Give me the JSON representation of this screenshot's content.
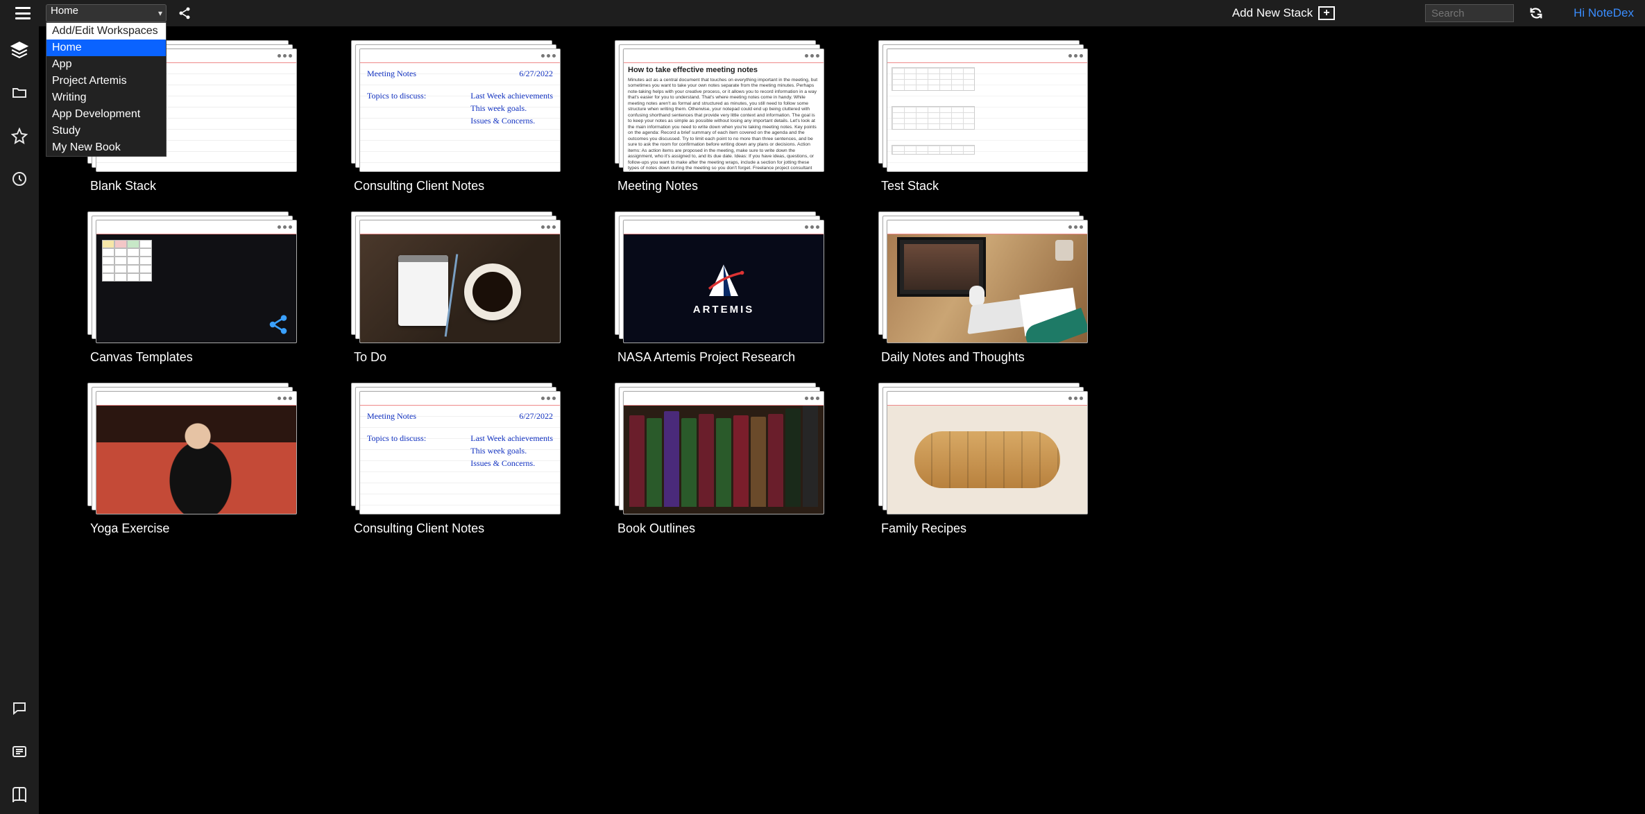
{
  "topbar": {
    "workspace_selected": "Home",
    "workspace_options": [
      "Add/Edit Workspaces",
      "Home",
      "App",
      "Project Artemis",
      "Writing",
      "App Development",
      "Study",
      "My New Book"
    ],
    "add_stack_label": "Add New Stack",
    "search_placeholder": "Search",
    "greeting": "Hi NoteDex"
  },
  "stacks": [
    {
      "title": "Blank Stack",
      "preview": "blank"
    },
    {
      "title": "Consulting Client Notes",
      "preview": "handwriting"
    },
    {
      "title": "Meeting Notes",
      "preview": "typed"
    },
    {
      "title": "Test Stack",
      "preview": "calendars"
    },
    {
      "title": "Canvas Templates",
      "preview": "darkcanvas"
    },
    {
      "title": "To Do",
      "preview": "coffee"
    },
    {
      "title": "NASA Artemis Project Research",
      "preview": "artemis"
    },
    {
      "title": "Daily Notes and Thoughts",
      "preview": "desk"
    },
    {
      "title": "Yoga Exercise",
      "preview": "yoga"
    },
    {
      "title": "Consulting Client Notes",
      "preview": "handwriting"
    },
    {
      "title": "Book Outlines",
      "preview": "books"
    },
    {
      "title": "Family Recipes",
      "preview": "bread"
    }
  ],
  "handwriting_preview": {
    "header_left": "Meeting Notes",
    "header_right": "6/27/2022",
    "line1": "Topics to discuss:",
    "bullets": [
      "Last Week achievements",
      "This week goals.",
      "Issues & Concerns."
    ]
  },
  "typed_preview": {
    "title": "How to take effective meeting notes",
    "body": "Minutes act as a central document that touches on everything important in the meeting, but sometimes you want to take your own notes separate from the meeting minutes. Perhaps note-taking helps with your creative process, or it allows you to record information in a way that's easier for you to understand. That's where meeting notes come in handy. While meeting notes aren't as formal and structured as minutes, you still need to follow some structure when writing them. Otherwise, your notepad could end up being cluttered with confusing shorthand sentences that provide very little context and information. The goal is to keep your notes as simple as possible without losing any important details. Let's look at the main information you need to write down when you're taking meeting notes. Key points on the agenda: Record a brief summary of each item covered on the agenda and the outcomes you discussed. Try to limit each point to no more than three sentences, and be sure to ask the room for confirmation before writing down any plans or decisions. Action items: As action items are proposed in the meeting, make sure to write down the assignment, who it's assigned to, and its due date. Ideas: If you have ideas, questions, or follow-ups you want to make after the meeting wraps, include a section for jotting these types of notes down during the meeting so you don't forget. Freelance project consultant Claire Emerson says there are a few key ways she has learned to take A+ meeting notes: 'Use the meeting agenda to reflect what's discussed so you don't double up on that info, make it clear what needs to be done as a result from the meeting, record the audio so nothing gets missed, and then send your notes out to all attendees making it clear who has homework due.'  Text courtesy Monday.com"
  },
  "artemis_preview": {
    "label": "ARTEMIS"
  }
}
